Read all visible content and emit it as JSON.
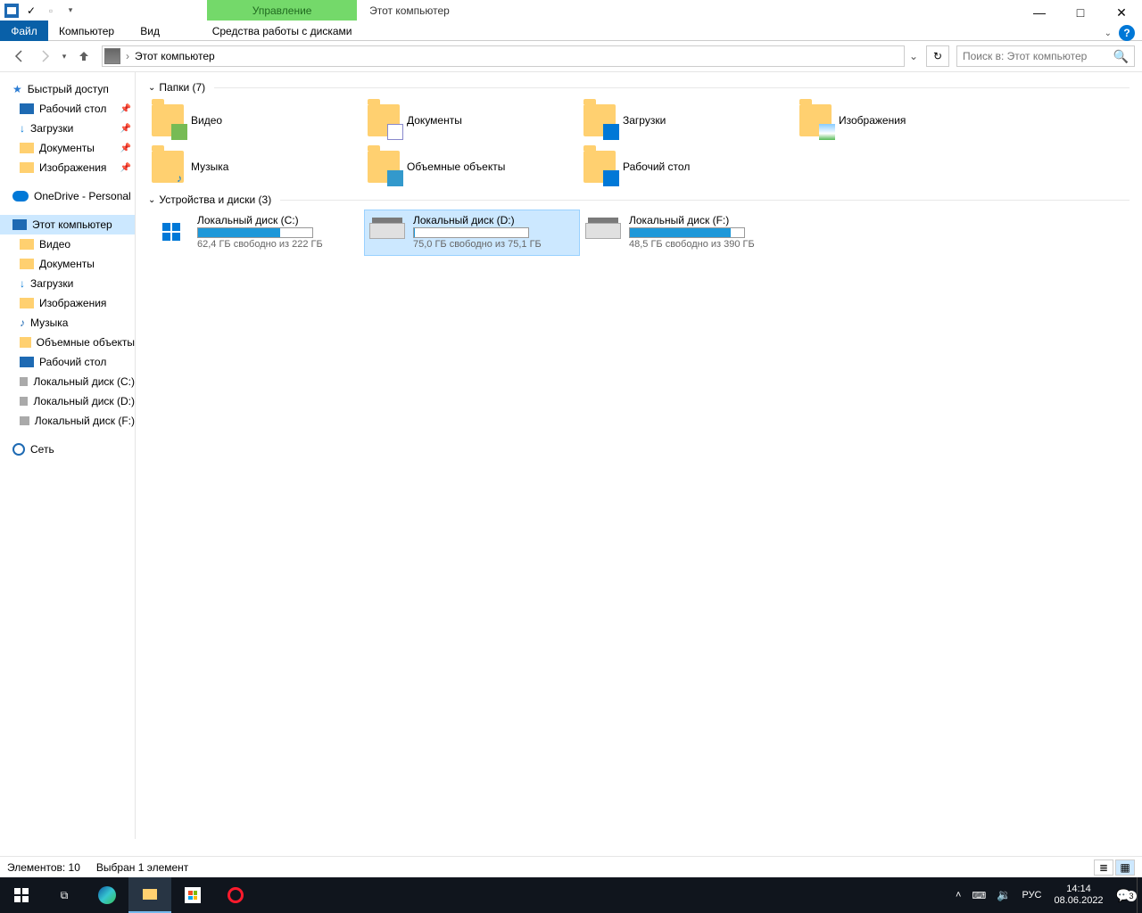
{
  "window": {
    "title": "Этот компьютер"
  },
  "qat_context_header": "Управление",
  "tabs": {
    "file": "Файл",
    "computer": "Компьютер",
    "view": "Вид",
    "drive_tools": "Средства работы с дисками"
  },
  "address": {
    "location": "Этот компьютер"
  },
  "search_placeholder": "Поиск в: Этот компьютер",
  "sidebar": {
    "quick_access": "Быстрый доступ",
    "desktop": "Рабочий стол",
    "downloads": "Загрузки",
    "documents": "Документы",
    "pictures": "Изображения",
    "onedrive": "OneDrive - Personal",
    "this_pc": "Этот компьютер",
    "videos": "Видео",
    "documents2": "Документы",
    "downloads2": "Загрузки",
    "pictures2": "Изображения",
    "music": "Музыка",
    "objects3d": "Объемные объекты",
    "desktop2": "Рабочий стол",
    "disk_c": "Локальный диск (C:)",
    "disk_d": "Локальный диск (D:)",
    "disk_f": "Локальный диск (F:)",
    "network": "Сеть"
  },
  "groups": {
    "folders": "Папки (7)",
    "drives": "Устройства и диски (3)"
  },
  "folders": {
    "videos": "Видео",
    "documents": "Документы",
    "downloads": "Загрузки",
    "pictures": "Изображения",
    "music": "Музыка",
    "objects3d": "Объемные объекты",
    "desktop": "Рабочий стол"
  },
  "drives": {
    "c": {
      "name": "Локальный диск (C:)",
      "free": "62,4 ГБ свободно из 222 ГБ",
      "pct": 72
    },
    "d": {
      "name": "Локальный диск (D:)",
      "free": "75,0 ГБ свободно из 75,1 ГБ",
      "pct": 1
    },
    "f": {
      "name": "Локальный диск (F:)",
      "free": "48,5 ГБ свободно из 390 ГБ",
      "pct": 88
    }
  },
  "status": {
    "items": "Элементов: 10",
    "selected": "Выбран 1 элемент"
  },
  "tray": {
    "lang": "РУС",
    "time": "14:14",
    "date": "08.06.2022",
    "notif": "3"
  }
}
